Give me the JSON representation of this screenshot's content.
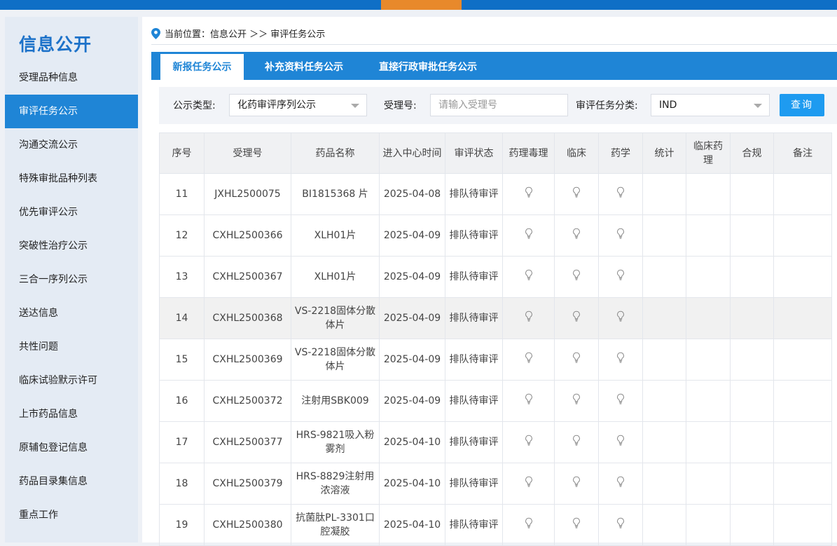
{
  "sidebar": {
    "title": "信息公开",
    "items": [
      {
        "label": "受理品种信息"
      },
      {
        "label": "审评任务公示"
      },
      {
        "label": "沟通交流公示"
      },
      {
        "label": "特殊审批品种列表"
      },
      {
        "label": "优先审评公示"
      },
      {
        "label": "突破性治疗公示"
      },
      {
        "label": "三合一序列公示"
      },
      {
        "label": "送达信息"
      },
      {
        "label": "共性问题"
      },
      {
        "label": "临床试验默示许可"
      },
      {
        "label": "上市药品信息"
      },
      {
        "label": "原辅包登记信息"
      },
      {
        "label": "药品目录集信息"
      },
      {
        "label": "重点工作"
      }
    ],
    "active_index": 1
  },
  "breadcrumb": {
    "text": "当前位置：信息公开 ＞＞ 审评任务公示"
  },
  "tabs": [
    {
      "label": "新报任务公示"
    },
    {
      "label": "补充资料任务公示"
    },
    {
      "label": "直接行政审批任务公示"
    }
  ],
  "filter": {
    "type_label": "公示类型:",
    "type_value": "化药审评序列公示",
    "acceptance_label": "受理号:",
    "acceptance_placeholder": "请输入受理号",
    "category_label": "审评任务分类:",
    "category_value": "IND",
    "query_label": "查询"
  },
  "colors": {
    "brand": "#1f85d6",
    "accent": "#e8892b",
    "button": "#1e9bf0"
  },
  "table": {
    "headers": [
      "序号",
      "受理号",
      "药品名称",
      "进入中心时间",
      "审评状态",
      "药理毒理",
      "临床",
      "药学",
      "统计",
      "临床药理",
      "合规",
      "备注"
    ],
    "status_icon": "lightbulb-icon",
    "rows": [
      {
        "no": "11",
        "acc": "JXHL2500075",
        "name": "BI1815368 片",
        "date": "2025-04-08",
        "status": "排队待审评"
      },
      {
        "no": "12",
        "acc": "CXHL2500366",
        "name": "XLH01片",
        "date": "2025-04-09",
        "status": "排队待审评"
      },
      {
        "no": "13",
        "acc": "CXHL2500367",
        "name": "XLH01片",
        "date": "2025-04-09",
        "status": "排队待审评"
      },
      {
        "no": "14",
        "acc": "CXHL2500368",
        "name": "VS-2218固体分散体片",
        "date": "2025-04-09",
        "status": "排队待审评"
      },
      {
        "no": "15",
        "acc": "CXHL2500369",
        "name": "VS-2218固体分散体片",
        "date": "2025-04-09",
        "status": "排队待审评"
      },
      {
        "no": "16",
        "acc": "CXHL2500372",
        "name": "注射用SBK009",
        "date": "2025-04-09",
        "status": "排队待审评"
      },
      {
        "no": "17",
        "acc": "CXHL2500377",
        "name": "HRS-9821吸入粉雾剂",
        "date": "2025-04-10",
        "status": "排队待审评"
      },
      {
        "no": "18",
        "acc": "CXHL2500379",
        "name": "HRS-8829注射用浓溶液",
        "date": "2025-04-10",
        "status": "排队待审评"
      },
      {
        "no": "19",
        "acc": "CXHL2500380",
        "name": "抗菌肽PL-3301口腔凝胶",
        "date": "2025-04-10",
        "status": "排队待审评"
      }
    ]
  }
}
